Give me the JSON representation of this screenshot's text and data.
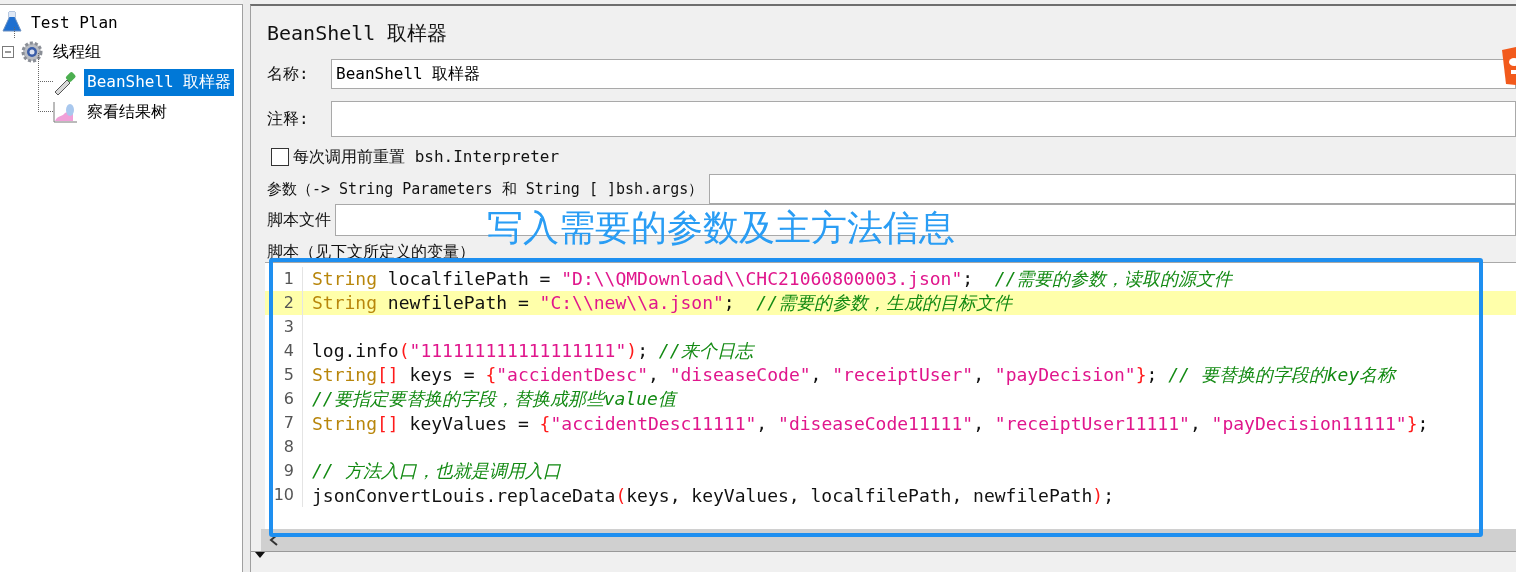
{
  "tree": {
    "label": "Test Plan",
    "kind": "flask",
    "children": [
      {
        "label": "线程组",
        "kind": "gear",
        "expanded": true,
        "children": [
          {
            "label": "BeanShell 取样器",
            "kind": "dropper",
            "selected": true
          },
          {
            "label": "察看结果树",
            "kind": "chart",
            "selected": false
          }
        ]
      }
    ]
  },
  "panel": {
    "title": "BeanShell 取样器",
    "name": {
      "label": "名称:",
      "value": "BeanShell 取样器"
    },
    "comment": {
      "label": "注释:"
    },
    "reset": {
      "label": "每次调用前重置 bsh.Interpreter",
      "checked": false
    },
    "params": {
      "label": "参数（-> String Parameters 和 String [ ]bsh.args）"
    },
    "script_file": {
      "label": "脚本文件"
    },
    "script_label": "脚本（见下文所定义的变量）",
    "code": [
      {
        "number": "1",
        "highlighted": false,
        "tokens": [
          {
            "kind": "keyword",
            "text": "String"
          },
          {
            "kind": "plain",
            "text": " localfilePath = "
          },
          {
            "kind": "string",
            "text": "\"D:\\\\QMDownload\\\\CHC21060800003.json\""
          },
          {
            "kind": "plain",
            "text": ";  "
          },
          {
            "kind": "comment",
            "text": "//需要的参数，读取的源文件"
          }
        ]
      },
      {
        "number": "2",
        "highlighted": true,
        "tokens": [
          {
            "kind": "keyword",
            "text": "String"
          },
          {
            "kind": "plain",
            "text": " newfilePath = "
          },
          {
            "kind": "string",
            "text": "\"C:\\\\new\\\\a.json\""
          },
          {
            "kind": "plain",
            "text": ";  "
          },
          {
            "kind": "comment",
            "text": "//需要的参数，生成的目标文件"
          }
        ]
      },
      {
        "number": "3",
        "highlighted": false
      },
      {
        "number": "4",
        "highlighted": false,
        "tokens": [
          {
            "kind": "plain",
            "text": "log.info"
          },
          {
            "kind": "bracket",
            "text": "("
          },
          {
            "kind": "string",
            "text": "\"111111111111111111\""
          },
          {
            "kind": "bracket",
            "text": ")"
          },
          {
            "kind": "plain",
            "text": "; "
          },
          {
            "kind": "comment",
            "text": "//来个日志"
          }
        ]
      },
      {
        "number": "5",
        "highlighted": false,
        "tokens": [
          {
            "kind": "keyword",
            "text": "String"
          },
          {
            "kind": "bracket",
            "text": "[]"
          },
          {
            "kind": "plain",
            "text": " keys = "
          },
          {
            "kind": "bracket",
            "text": "{"
          },
          {
            "kind": "string",
            "text": "\"accidentDesc\""
          },
          {
            "kind": "plain",
            "text": ", "
          },
          {
            "kind": "string",
            "text": "\"diseaseCode\""
          },
          {
            "kind": "plain",
            "text": ", "
          },
          {
            "kind": "string",
            "text": "\"receiptUser\""
          },
          {
            "kind": "plain",
            "text": ", "
          },
          {
            "kind": "string",
            "text": "\"payDecision\""
          },
          {
            "kind": "bracket",
            "text": "}"
          },
          {
            "kind": "plain",
            "text": "; "
          },
          {
            "kind": "comment",
            "text": "// 要替换的字段的key名称"
          }
        ]
      },
      {
        "number": "6",
        "highlighted": false,
        "tokens": [
          {
            "kind": "comment",
            "text": "//要指定要替换的字段，替换成那些value值"
          }
        ]
      },
      {
        "number": "7",
        "highlighted": false,
        "tokens": [
          {
            "kind": "keyword",
            "text": "String"
          },
          {
            "kind": "bracket",
            "text": "[]"
          },
          {
            "kind": "plain",
            "text": " keyValues = "
          },
          {
            "kind": "bracket",
            "text": "{"
          },
          {
            "kind": "string",
            "text": "\"accidentDesc11111\""
          },
          {
            "kind": "plain",
            "text": ", "
          },
          {
            "kind": "string",
            "text": "\"diseaseCode11111\""
          },
          {
            "kind": "plain",
            "text": ", "
          },
          {
            "kind": "string",
            "text": "\"receiptUser11111\""
          },
          {
            "kind": "plain",
            "text": ", "
          },
          {
            "kind": "string",
            "text": "\"payDecision11111\""
          },
          {
            "kind": "bracket",
            "text": "}"
          },
          {
            "kind": "plain",
            "text": ";"
          }
        ]
      },
      {
        "number": "8",
        "highlighted": false
      },
      {
        "number": "9",
        "highlighted": false,
        "tokens": [
          {
            "kind": "comment",
            "text": "// 方法入口，也就是调用入口"
          }
        ]
      },
      {
        "number": "10",
        "highlighted": false,
        "tokens": [
          {
            "kind": "plain",
            "text": "jsonConvertLouis.replaceData"
          },
          {
            "kind": "bracket",
            "text": "("
          },
          {
            "kind": "plain",
            "text": "keys, keyValues, localfilePath, newfilePath"
          },
          {
            "kind": "bracket",
            "text": ")"
          },
          {
            "kind": "plain",
            "text": ";"
          }
        ]
      }
    ]
  },
  "annotation": {
    "text": "写入需要的参数及主方法信息"
  }
}
